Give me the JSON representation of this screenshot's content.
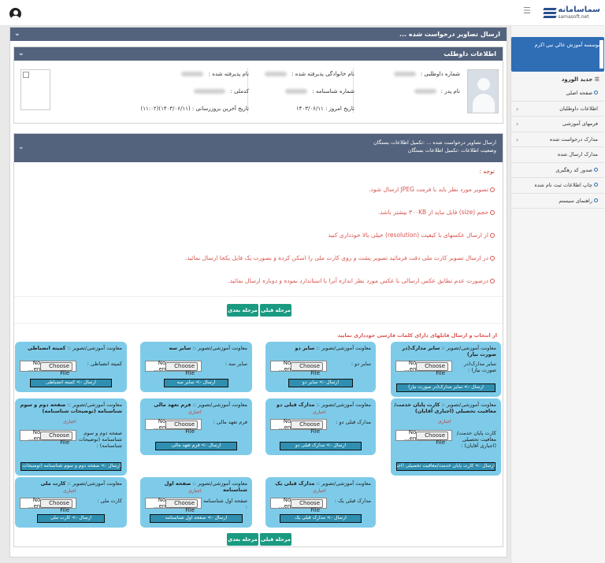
{
  "topbar": {
    "brand_fa": "سماسامانه",
    "brand_en": "samasoft.net"
  },
  "sidebar": {
    "org": "موسسه آموزش عالي نبي اکرم",
    "section": "جدید الورود",
    "items": [
      {
        "label": "صفحه اصلی",
        "icon": "dot"
      },
      {
        "label": "اطلاعات داوطلبان",
        "icon": "chev"
      },
      {
        "label": "فرمهای آموزشی",
        "icon": "chev"
      },
      {
        "label": "مدارک درخواست شده",
        "icon": "chev"
      },
      {
        "label": "مدارک ارسال شده",
        "icon": "none"
      },
      {
        "label": "صدور کد رهگیری",
        "icon": "dot"
      },
      {
        "label": "چاپ اطلاعات ثبت نام شده",
        "icon": "dot"
      },
      {
        "label": "راهنمای سیستم",
        "icon": "dot"
      }
    ]
  },
  "main": {
    "title": "ارسال تصاویر درخواست شده ..."
  },
  "info": {
    "title": "اطلاعات داوطلب",
    "applicant_no": "شماره داوطلبی : ",
    "family_name": "نام خانوادگی پذیرفته شده : ",
    "accepted_name": "نام پذیرفته شده : ",
    "father": "نام پدر : ",
    "id_no": "شماره شناسنامه : ",
    "national_code": "کدملی : ",
    "today": "تاریخ امروز : ۱۴۰۳/۰۶/۱۱",
    "last_update": "تاریخ آخرین بروزرسانی : (۱۴۰۳/۰۶/۱۱)(۱۱:۰۲)"
  },
  "upload": {
    "line1": "ارسال تصاویر درخواست شده ... :تکمیل اطلاعات بستگان",
    "line2": "وضعیت اطلاعات :تکمیل اطلاعات بستگان",
    "notes_title": "توجه :",
    "notes": [
      "تصویر مورد نظر باید با فرمت JPEG ارسال شود.",
      "حجم (size) فایل نباید از ۳۰۰KB بیشتر باشد.",
      "از ارسال عکسهای با کیفیت (resolution) خیلی بالا خودداری کنید",
      "در ارسال تصویر کارت ملی دقت فرمائید تصویر پشت و روی کارت ملی را اسکن کرده و بصورت یک فایل یکجا ارسال نمائید.",
      "درصورت عدم تطابق عکس ارسالی با عکس مورد نظر اندازه آنرا با استاندارد نموده و دوباره ارسال نمائید."
    ],
    "prev": "مرحله قبلی",
    "next": "مرحله بعدی",
    "warning": "از انتخاب و ارسال فایلهای دارای کلمات فارسی خودداری نمایید",
    "file_text": "No ...en",
    "choose": "Choose File",
    "dept": "معاونت آموزشی/تصویر :: ",
    "required": "اجباری"
  },
  "cards": [
    {
      "title": "سایر مدارک(در صورت نیاز)",
      "label": "سایر مدارک(در صورت نیاز) :",
      "send": "ارسال -> سایر مدارک(در صورت نیاز)",
      "required": false
    },
    {
      "title": "سایر دو",
      "label": "سایر دو :",
      "send": "ارسال -> سایر دو",
      "required": false
    },
    {
      "title": "سایر سه",
      "label": "سایر سه :",
      "send": "ارسال -> سایر سه",
      "required": false
    },
    {
      "title": "کمیته انضباطی",
      "label": "کمیته انضباطی :",
      "send": "ارسال -> کمیته انضباطی",
      "required": false
    },
    {
      "title": "کارت پایان خدمت/معافیت تحصیلی (اجباری آقایان)",
      "label": "کارت پایان خدمت/ معافیت تحصیلی (اجباری آقایان) :",
      "send": "ارسال -> کارت پایان خدمت/معافیت تحصیلی (اجباری آقایان)",
      "required": true
    },
    {
      "title": "مدارک قبلی دو",
      "label": "مدارک قبلی دو :",
      "send": "ارسال -> مدارک قبلی دو",
      "required": true
    },
    {
      "title": "فرم تعهد مالی",
      "label": "فرم تعهد مالی :",
      "send": "ارسال -> فرم تعهد مالی",
      "required": true
    },
    {
      "title": "صفحه دوم و سوم شناسنامه (توضیحات شناسنامه)",
      "label": "صفحه دوم و سوم شناسنامه (توضیحات شناسنامه) :",
      "send": "ارسال -> صفحه دوم و سوم شناسنامه (توضیحات شناسنامه)",
      "required": true
    },
    {
      "title": "مدارک قبلی یک",
      "label": "مدارک قبلی یک :",
      "send": "ارسال -> مدارک قبلی یک",
      "required": true
    },
    {
      "title": "صفحه اول شناسنامه",
      "label": "صفحه اول شناسنامه :",
      "send": "ارسال -> صفحه اول شناسنامه",
      "required": true
    },
    {
      "title": "کارت ملی",
      "label": "کارت ملی :",
      "send": "ارسال -> کارت ملی",
      "required": true
    }
  ]
}
